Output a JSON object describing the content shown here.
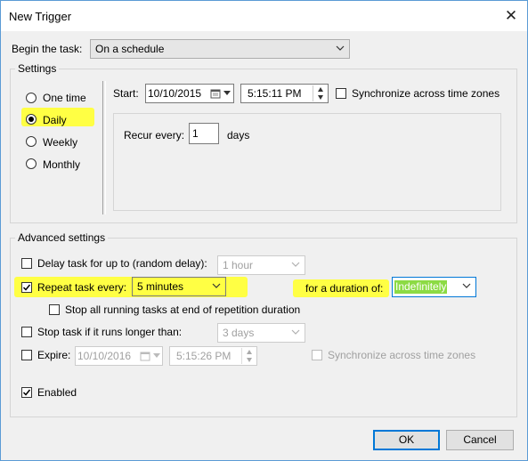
{
  "window": {
    "title": "New Trigger"
  },
  "begin": {
    "label": "Begin the task:",
    "value": "On a schedule"
  },
  "settings": {
    "label": "Settings",
    "radios": [
      {
        "label": "One time",
        "selected": false
      },
      {
        "label": "Daily",
        "selected": true
      },
      {
        "label": "Weekly",
        "selected": false
      },
      {
        "label": "Monthly",
        "selected": false
      }
    ],
    "start_label": "Start:",
    "start_date": "10/10/2015",
    "start_time": "5:15:11 PM",
    "sync_label": "Synchronize across time zones",
    "recur_label": "Recur every:",
    "recur_value": "1",
    "recur_unit": "days"
  },
  "advanced": {
    "label": "Advanced settings",
    "delay_label": "Delay task for up to (random delay):",
    "delay_value": "1 hour",
    "repeat_label": "Repeat task every:",
    "repeat_value": "5 minutes",
    "duration_label": "for a duration of:",
    "duration_value": "Indefinitely",
    "stop_all_label": "Stop all running tasks at end of repetition duration",
    "stop_longer_label": "Stop task if it runs longer than:",
    "stop_longer_value": "3 days",
    "expire_label": "Expire:",
    "expire_date": "10/10/2016",
    "expire_time": "5:15:26 PM",
    "expire_sync_label": "Synchronize across time zones",
    "enabled_label": "Enabled"
  },
  "buttons": {
    "ok": "OK",
    "cancel": "Cancel"
  },
  "colors": {
    "highlight": "#ffff3a",
    "focus": "#0078d7",
    "selection_green": "#00b050"
  }
}
